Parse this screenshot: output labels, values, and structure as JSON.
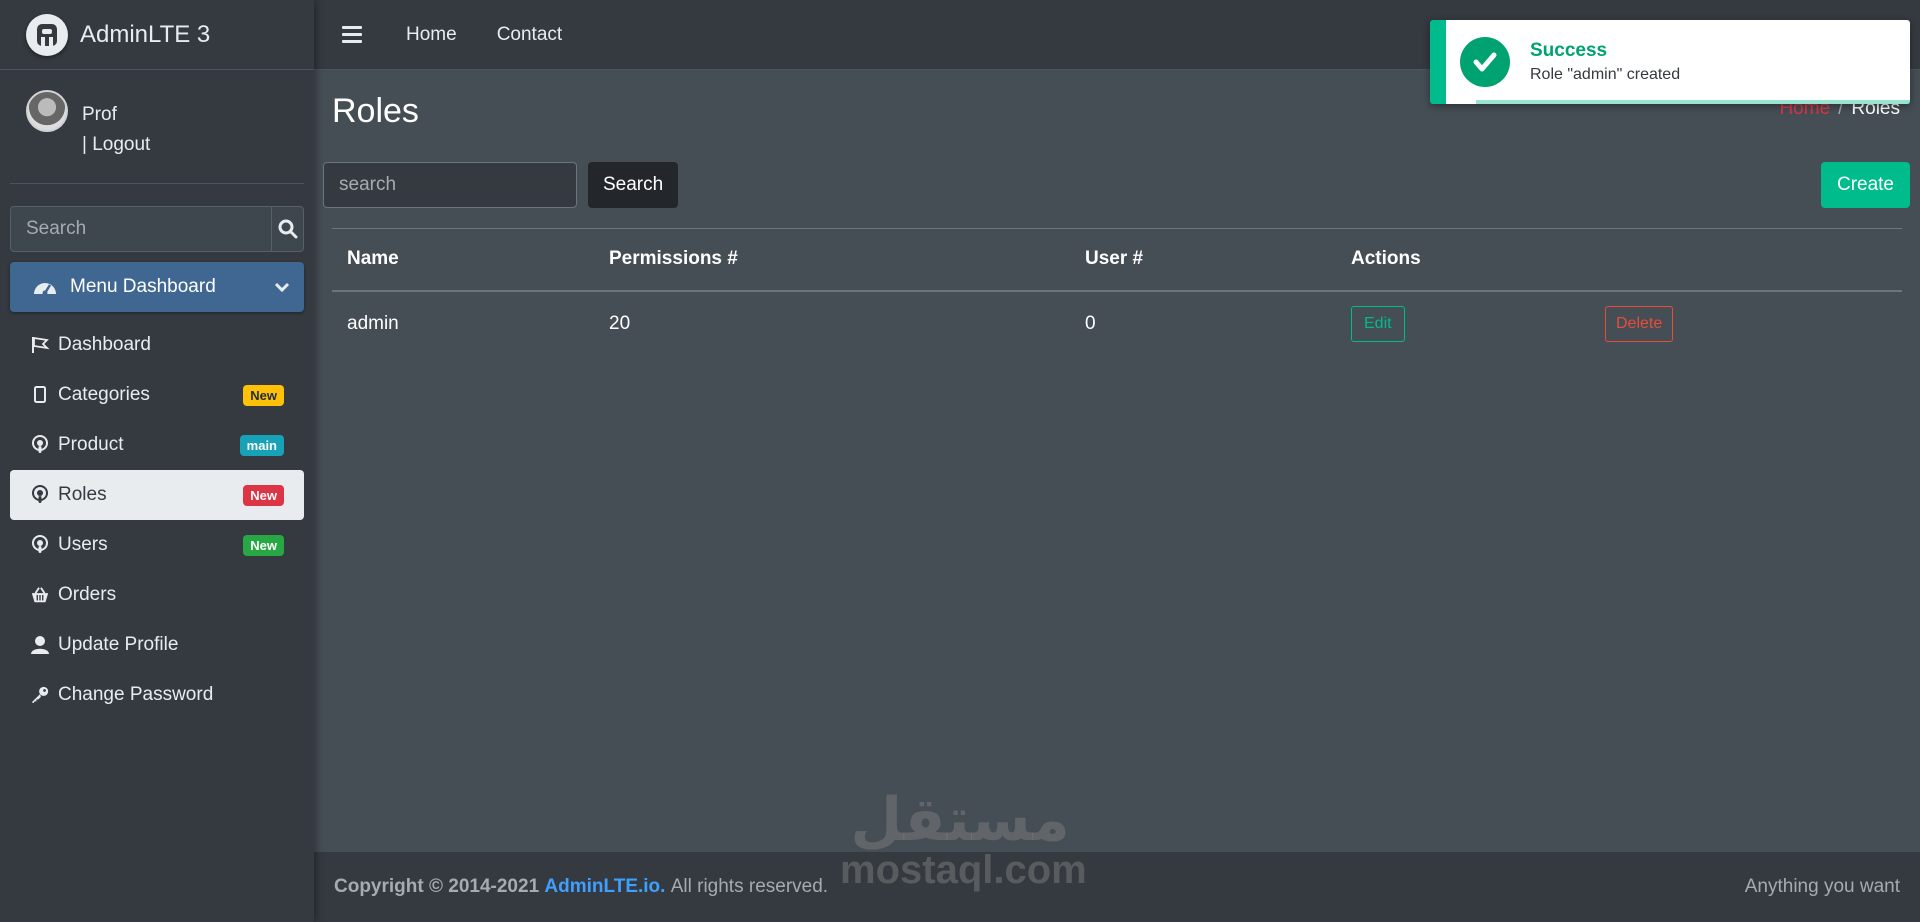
{
  "brand": {
    "name": "AdminLTE 3"
  },
  "user": {
    "name": "Prof",
    "logout": "| Logout"
  },
  "sidebar": {
    "search_placeholder": "Search",
    "menu_header": "Menu Dashboard",
    "items": [
      {
        "label": "Dashboard",
        "icon": "flag-icon",
        "badge": ""
      },
      {
        "label": "Categories",
        "icon": "tablet-icon",
        "badge": "New"
      },
      {
        "label": "Product",
        "icon": "podcast-icon",
        "badge": "main"
      },
      {
        "label": "Roles",
        "icon": "podcast-icon",
        "badge": "New"
      },
      {
        "label": "Users",
        "icon": "podcast-icon",
        "badge": "New"
      },
      {
        "label": "Orders",
        "icon": "basket-icon",
        "badge": ""
      },
      {
        "label": "Update Profile",
        "icon": "user-icon",
        "badge": ""
      },
      {
        "label": "Change Password",
        "icon": "key-icon",
        "badge": ""
      }
    ]
  },
  "topbar": {
    "home": "Home",
    "contact": "Contact"
  },
  "page": {
    "title": "Roles",
    "breadcrumb_home": "Home",
    "breadcrumb_sep": "/",
    "breadcrumb_current": "Roles",
    "search_placeholder": "search",
    "search_button": "Search",
    "create_button": "Create"
  },
  "table": {
    "headers": [
      "Name",
      "Permissions #",
      "User #",
      "Actions"
    ],
    "rows": [
      {
        "name": "admin",
        "permissions": "20",
        "users": "0",
        "edit": "Edit",
        "delete": "Delete"
      }
    ]
  },
  "footer": {
    "copyright": "Copyright © 2014-2021",
    "brand": "AdminLTE.io.",
    "rights": "All rights reserved.",
    "right_text": "Anything you want"
  },
  "toast": {
    "title": "Success",
    "message": "Role \"admin\" created"
  },
  "watermark": {
    "arabic": "مستقل",
    "latin": "mostaql.com"
  },
  "colors": {
    "accent": "#00bc8c",
    "danger": "#dc3545",
    "primary_menu": "#3f6791"
  }
}
